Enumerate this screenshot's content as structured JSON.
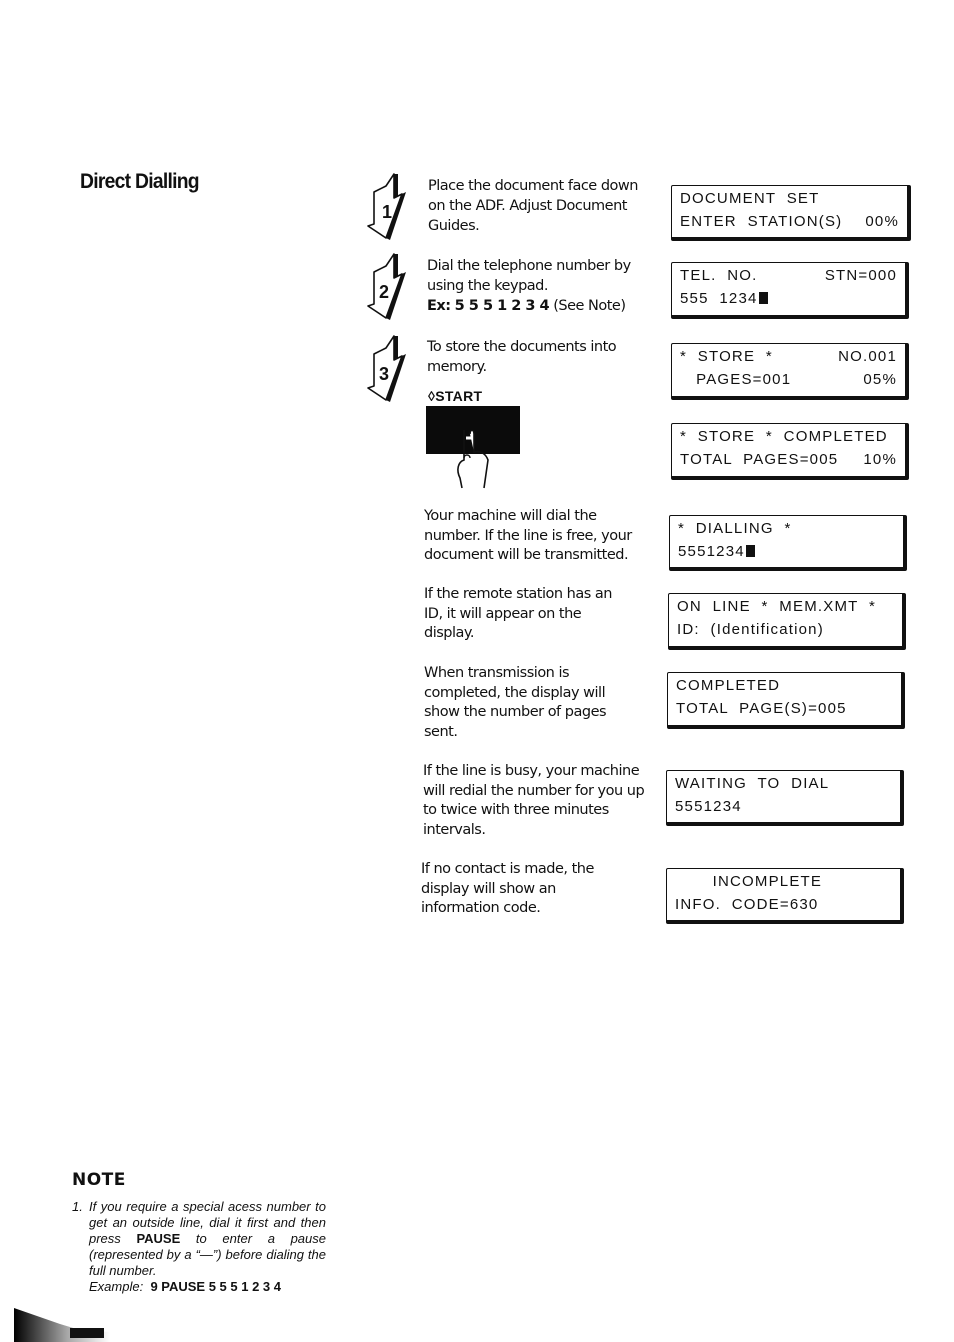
{
  "page": {
    "title": "Direct Dialling"
  },
  "steps": [
    {
      "number": "1",
      "icon": "step-arrow-icon",
      "text": "Place the document face down on the ADF. Adjust Document Guides."
    },
    {
      "number": "2",
      "icon": "step-arrow-icon",
      "text": "Dial the telephone number by using the keypad.",
      "example_prefix": "Ex:",
      "example_value": "5 5 5 1 2 3 4",
      "example_suffix": "(See Note)"
    },
    {
      "number": "3",
      "icon": "step-arrow-icon",
      "text": "To store the documents into memory.",
      "key_label": "START",
      "key_icon": "start-diamond-icon"
    }
  ],
  "paragraphs": [
    "Your machine will dial the number. If the line is free, your document will be transmitted.",
    "If the remote station has an ID, it will appear on the display.",
    "When transmission is completed, the display will show the number of pages sent.",
    "If the line is busy, your machine will redial the number for you up to twice with three minutes intervals.",
    "If no contact is made, the display will show an information code."
  ],
  "displays": [
    {
      "line1_left": "DOCUMENT  SET",
      "line1_right": "",
      "line2_left": "ENTER  STATION(S)",
      "line2_right": "00%",
      "cursor": false
    },
    {
      "line1_left": "TEL.  NO.",
      "line1_right": "STN=000",
      "line2_left": "555  1234",
      "line2_right": "",
      "cursor": true
    },
    {
      "line1_left": "*  STORE  *",
      "line1_right": "NO.001",
      "line2_left": "   PAGES=001",
      "line2_right": "05%",
      "cursor": false
    },
    {
      "line1_left": "*  STORE  *  COMPLETED",
      "line1_right": "",
      "line2_left": "TOTAL  PAGES=005",
      "line2_right": "10%",
      "cursor": false
    },
    {
      "line1_left": "*  DIALLING  *",
      "line1_right": "",
      "line2_left": "5551234",
      "line2_right": "",
      "cursor": true
    },
    {
      "line1_left": "ON  LINE  *  MEM.XMT  *",
      "line1_right": "",
      "line2_left": "ID:  (Identification)",
      "line2_right": "",
      "cursor": false
    },
    {
      "line1_left": "COMPLETED",
      "line1_right": "",
      "line2_left": "TOTAL  PAGE(S)=005",
      "line2_right": "",
      "cursor": false
    },
    {
      "line1_left": "WAITING  TO  DIAL",
      "line1_right": "",
      "line2_left": "5551234",
      "line2_right": "",
      "cursor": false
    },
    {
      "line1_left": "       INCOMPLETE",
      "line1_right": "",
      "line2_left": "INFO.  CODE=630",
      "line2_right": "",
      "cursor": false
    }
  ],
  "note": {
    "heading": "NOTE",
    "number": "1.",
    "text_1": "If you require a special acess number to get an outside line, dial it first and then press ",
    "bold_1": "PAUSE",
    "text_2": " to enter a pause (represented by a “—”) before dialing the full number.",
    "example_label": "Example:",
    "example_value": "9 PAUSE 5 5 5 1 2 3 4"
  }
}
